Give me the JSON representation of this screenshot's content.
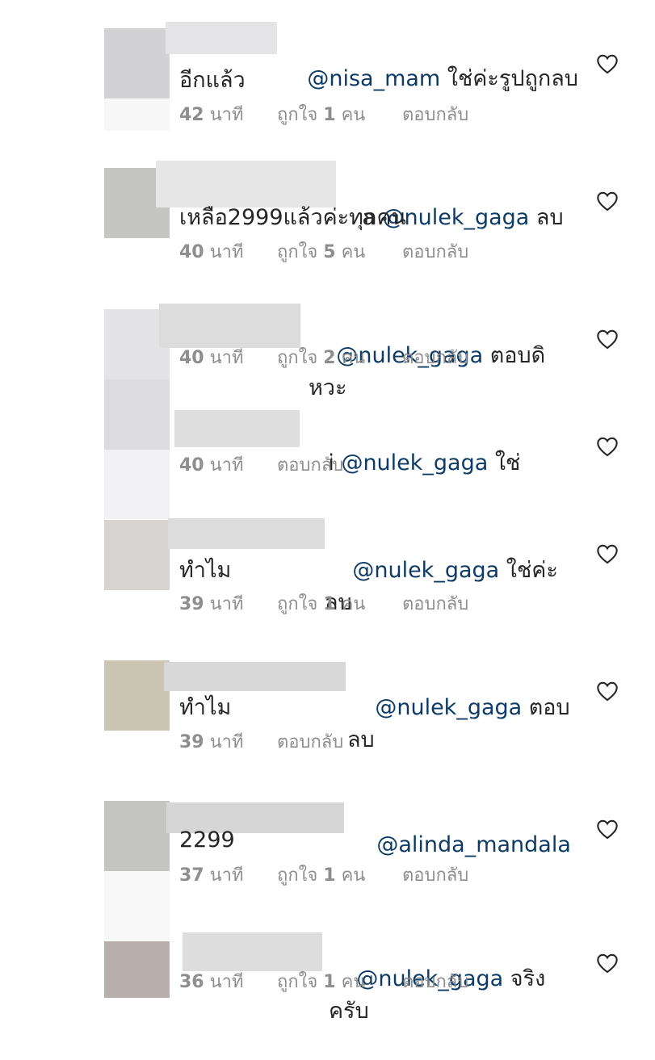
{
  "comments": [
    {
      "prefix": "",
      "mention": "@nisa_mam",
      "text": " ใช่ค่ะรูปถูกลบ",
      "line2": "อีกแล้ว",
      "time_num": "42",
      "time_unit": " นาที",
      "likes_pre": "ถูกใจ ",
      "likes_num": "1",
      "likes_post": " คน",
      "reply": "ตอบกลับ",
      "avatar_color": "#d2d1d3"
    },
    {
      "prefix": "a ",
      "mention": "@nulek_gaga",
      "text": " ลบ",
      "line2": "เหลือ2999แล้วค่ะทุกคน",
      "time_num": "40",
      "time_unit": " นาที",
      "likes_pre": "ถูกใจ ",
      "likes_num": "5",
      "likes_post": " คน",
      "reply": "ตอบกลับ",
      "avatar_color": "#c5c6c1"
    },
    {
      "prefix": "",
      "mention": "@nulek_gaga",
      "text": " ตอบดิหวะ",
      "line2": "",
      "time_num": "40",
      "time_unit": " นาที",
      "likes_pre": "ถูกใจ ",
      "likes_num": "2",
      "likes_post": " คน",
      "reply": "ตอบกลับ",
      "avatar_color": "#e3e2e4"
    },
    {
      "prefix": "i ",
      "mention": "@nulek_gaga",
      "text": " ใช่",
      "line2": "",
      "time_num": "40",
      "time_unit": " นาที",
      "likes_pre": "",
      "likes_num": "",
      "likes_post": "",
      "reply": "ตอบกลับ",
      "avatar_color": "#dcdcdf"
    },
    {
      "prefix": "",
      "mention": "@nulek_gaga",
      "text": " ใช่ค่ะ ลบ",
      "line2": "ทำไม",
      "time_num": "39",
      "time_unit": " นาที",
      "likes_pre": "ถูกใจ ",
      "likes_num": "1",
      "likes_post": " คน",
      "reply": "ตอบกลับ",
      "avatar_color": "#d6d3d1"
    },
    {
      "prefix": "",
      "mention": "@nulek_gaga",
      "text": " ตอบลบ",
      "line2": "ทำไม",
      "time_num": "39",
      "time_unit": " นาที",
      "likes_pre": "",
      "likes_num": "",
      "likes_post": "",
      "reply": "ตอบกลับ",
      "avatar_color": "#cbc5b4"
    },
    {
      "prefix": "",
      "mention": "@alinda_mandala",
      "text": "",
      "line2": "2299",
      "time_num": "37",
      "time_unit": " นาที",
      "likes_pre": "ถูกใจ ",
      "likes_num": "1",
      "likes_post": " คน",
      "reply": "ตอบกลับ",
      "avatar_color": "#c4c4c2"
    },
    {
      "prefix": "",
      "mention": "@nulek_gaga",
      "text": " จริงครับ",
      "line2": "",
      "time_num": "36",
      "time_unit": " นาที",
      "likes_pre": "ถูกใจ ",
      "likes_num": "1",
      "likes_post": " คน",
      "reply": "ตอบกลับ",
      "avatar_color": "#b8aeab"
    }
  ],
  "colors": {
    "mention": "#0d3b66",
    "meta": "#8e8e8e",
    "text": "#262626"
  }
}
